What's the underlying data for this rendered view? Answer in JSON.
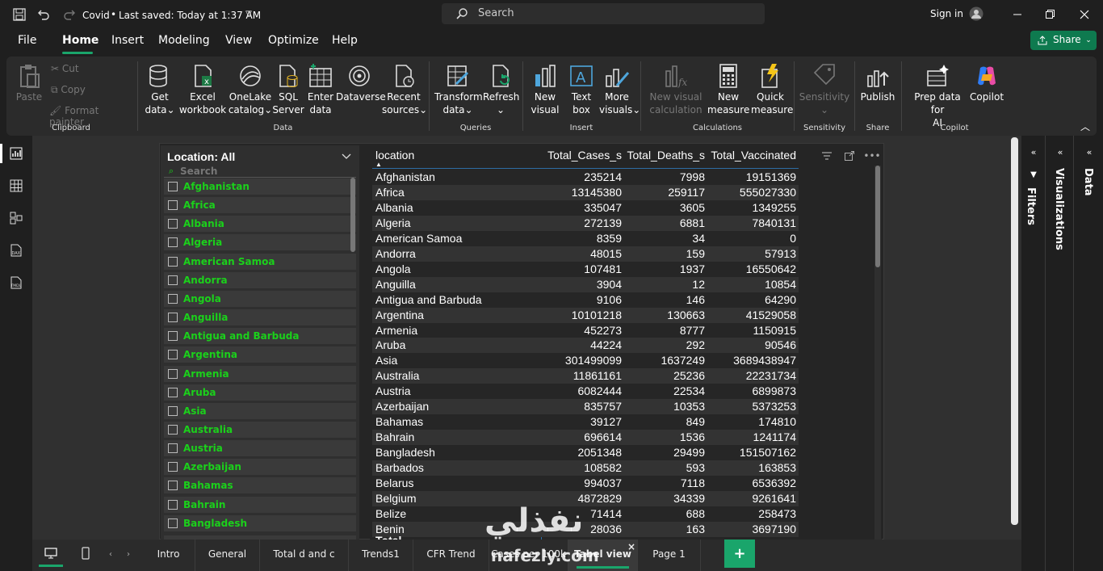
{
  "titlebar": {
    "doc_title": "Covid",
    "save_status": "Last saved: Today at 1:37 AM",
    "search_placeholder": "Search",
    "sign_in": "Sign in"
  },
  "menu": {
    "items": [
      "File",
      "Home",
      "Insert",
      "Modeling",
      "View",
      "Optimize",
      "Help"
    ],
    "active": "Home",
    "share": "Share"
  },
  "ribbon": {
    "clipboard": {
      "name": "Clipboard",
      "paste": "Paste",
      "cut": "Cut",
      "copy": "Copy",
      "format_painter": "Format painter"
    },
    "data": {
      "name": "Data",
      "get_data": [
        "Get",
        "data"
      ],
      "excel": [
        "Excel",
        "workbook"
      ],
      "onelake": [
        "OneLake",
        "catalog"
      ],
      "sql": [
        "SQL",
        "Server"
      ],
      "enter": [
        "Enter",
        "data"
      ],
      "dataverse": "Dataverse",
      "recent": [
        "Recent",
        "sources"
      ]
    },
    "queries": {
      "name": "Queries",
      "transform": [
        "Transform",
        "data"
      ],
      "refresh": "Refresh"
    },
    "insert": {
      "name": "Insert",
      "new_visual": [
        "New",
        "visual"
      ],
      "text_box": [
        "Text",
        "box"
      ],
      "more_visuals": [
        "More",
        "visuals"
      ]
    },
    "calculations": {
      "name": "Calculations",
      "new_visual_calc": [
        "New visual",
        "calculation"
      ],
      "new_measure": [
        "New",
        "measure"
      ],
      "quick_measure": [
        "Quick",
        "measure"
      ]
    },
    "sensitivity": {
      "name": "Sensitivity",
      "label": "Sensitivity"
    },
    "share": {
      "name": "Share",
      "publish": "Publish"
    },
    "copilot": {
      "name": "Copilot",
      "prep": [
        "Prep data for",
        "AI"
      ],
      "copilot": "Copilot"
    }
  },
  "slicer": {
    "title": "Location: All",
    "search_placeholder": "Search",
    "items": [
      "Afghanistan",
      "Africa",
      "Albania",
      "Algeria",
      "American Samoa",
      "Andorra",
      "Angola",
      "Anguilla",
      "Antigua and Barbuda",
      "Argentina",
      "Armenia",
      "Aruba",
      "Asia",
      "Australia",
      "Austria",
      "Azerbaijan",
      "Bahamas",
      "Bahrain",
      "Bangladesh"
    ]
  },
  "table": {
    "headers": [
      "location",
      "Total_Cases_s",
      "Total_Deaths_s",
      "Total_Vaccinated"
    ],
    "rows": [
      [
        "Afghanistan",
        "235214",
        "7998",
        "19151369"
      ],
      [
        "Africa",
        "13145380",
        "259117",
        "555027330"
      ],
      [
        "Albania",
        "335047",
        "3605",
        "1349255"
      ],
      [
        "Algeria",
        "272139",
        "6881",
        "7840131"
      ],
      [
        "American Samoa",
        "8359",
        "34",
        "0"
      ],
      [
        "Andorra",
        "48015",
        "159",
        "57913"
      ],
      [
        "Angola",
        "107481",
        "1937",
        "16550642"
      ],
      [
        "Anguilla",
        "3904",
        "12",
        "10854"
      ],
      [
        "Antigua and Barbuda",
        "9106",
        "146",
        "64290"
      ],
      [
        "Argentina",
        "10101218",
        "130663",
        "41529058"
      ],
      [
        "Armenia",
        "452273",
        "8777",
        "1150915"
      ],
      [
        "Aruba",
        "44224",
        "292",
        "90546"
      ],
      [
        "Asia",
        "301499099",
        "1637249",
        "3689438947"
      ],
      [
        "Australia",
        "11861161",
        "25236",
        "22231734"
      ],
      [
        "Austria",
        "6082444",
        "22534",
        "6899873"
      ],
      [
        "Azerbaijan",
        "835757",
        "10353",
        "5373253"
      ],
      [
        "Bahamas",
        "39127",
        "849",
        "174810"
      ],
      [
        "Bahrain",
        "696614",
        "1536",
        "1241174"
      ],
      [
        "Bangladesh",
        "2051348",
        "29499",
        "151507162"
      ],
      [
        "Barbados",
        "108582",
        "593",
        "163853"
      ],
      [
        "Belarus",
        "994037",
        "7118",
        "6536392"
      ],
      [
        "Belgium",
        "4872829",
        "34339",
        "9261641"
      ],
      [
        "Belize",
        "71414",
        "688",
        "258473"
      ],
      [
        "Benin",
        "28036",
        "163",
        "3697190"
      ]
    ]
  },
  "panes": {
    "filters": "Filters",
    "visualizations": "Visualizations",
    "data": "Data"
  },
  "tabs": [
    "Intro",
    "General",
    "Total d and c",
    "Trends1",
    "CFR Trend",
    "Cases per 100k",
    "Tabel view",
    "Page 1"
  ],
  "active_tab": "Tabel view",
  "watermark": "nafezly.com",
  "colors": {
    "slicer_text": "#1bd11b",
    "share_button": "#0e7a4f",
    "add_tab": "#1aa56b"
  }
}
